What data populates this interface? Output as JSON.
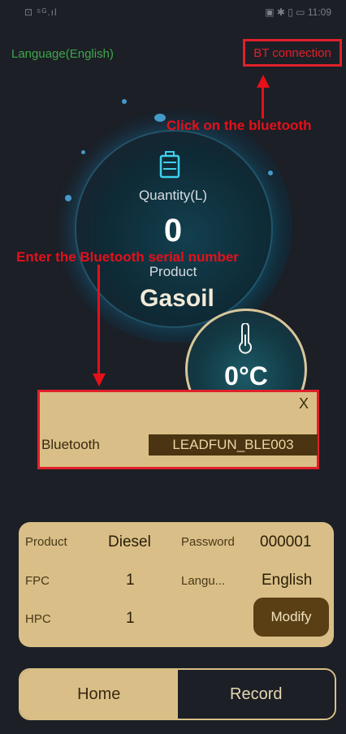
{
  "status_bar": {
    "left": "⊡ ⁵ᴳ.ıl",
    "right": "▣ ✱ ▯ ▭ 11:09"
  },
  "header": {
    "language_link": "Language(English)",
    "bt_button": "BT connection"
  },
  "annotations": {
    "click_bluetooth": "Click on the bluetooth",
    "enter_serial": "Enter the Bluetooth serial number"
  },
  "gauge": {
    "quantity_label": "Quantity(L)",
    "quantity_value": "0",
    "product_label": "Product",
    "product_value": "Gasoil",
    "temperature": "0°C"
  },
  "popup": {
    "close": "X",
    "label": "Bluetooth",
    "value": "LEADFUN_BLE003"
  },
  "info": {
    "product_label": "Product",
    "product_value": "Diesel",
    "password_label": "Password",
    "password_value": "000001",
    "fpc_label": "FPC",
    "fpc_value": "1",
    "language_label": "Langu...",
    "language_value": "English",
    "hpc_label": "HPC",
    "hpc_value": "1",
    "modify_button": "Modify"
  },
  "tabs": {
    "home": "Home",
    "record": "Record"
  },
  "colors": {
    "background": "#1c1f26",
    "accent_gold": "#d9bf87",
    "annotation_red": "#e5101a",
    "language_green": "#3fa64a"
  },
  "icons": {
    "fuel_can": "fuel-can-icon",
    "thermometer": "thermometer-icon"
  }
}
